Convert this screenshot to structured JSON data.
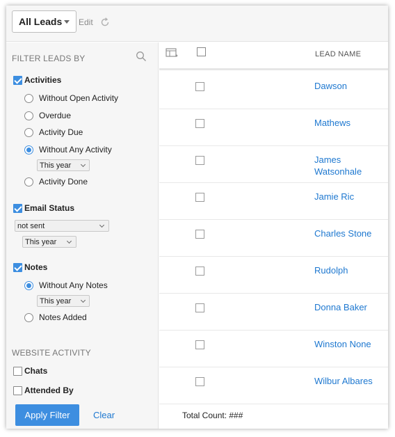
{
  "toolbar": {
    "view_label": "All Leads",
    "edit_label": "Edit"
  },
  "sidebar": {
    "filter_title": "FILTER LEADS BY",
    "activities": {
      "label": "Activities",
      "checked": true,
      "options": [
        {
          "label": "Without Open Activity",
          "selected": false
        },
        {
          "label": "Overdue",
          "selected": false
        },
        {
          "label": "Activity Due",
          "selected": false
        },
        {
          "label": "Without Any Activity",
          "selected": true
        },
        {
          "label": "Activity Done",
          "selected": false
        }
      ],
      "period": "This year"
    },
    "email_status": {
      "label": "Email Status",
      "checked": true,
      "status": "not sent",
      "period": "This year"
    },
    "notes": {
      "label": "Notes",
      "checked": true,
      "options": [
        {
          "label": "Without Any Notes",
          "selected": true
        },
        {
          "label": "Notes Added",
          "selected": false
        }
      ],
      "period": "This year"
    },
    "website_title": "WEBSITE ACTIVITY",
    "chats": {
      "label": "Chats",
      "checked": false
    },
    "attended_by": {
      "label": "Attended By",
      "checked": false
    },
    "apply_label": "Apply Filter",
    "clear_label": "Clear"
  },
  "table": {
    "column_header": "LEAD NAME",
    "rows": [
      {
        "name": "Dawson"
      },
      {
        "name": "Mathews"
      },
      {
        "name": "James Watsonhale"
      },
      {
        "name": "Jamie Ric"
      },
      {
        "name": "Charles Stone"
      },
      {
        "name": "Rudolph"
      },
      {
        "name": "Donna Baker"
      },
      {
        "name": "Winston None"
      },
      {
        "name": "Wilbur Albares"
      }
    ],
    "total_label": "Total Count: ###"
  },
  "colors": {
    "accent": "#3d8ee0",
    "link": "#1e78d0",
    "panel_bg": "#f6f6f6"
  }
}
